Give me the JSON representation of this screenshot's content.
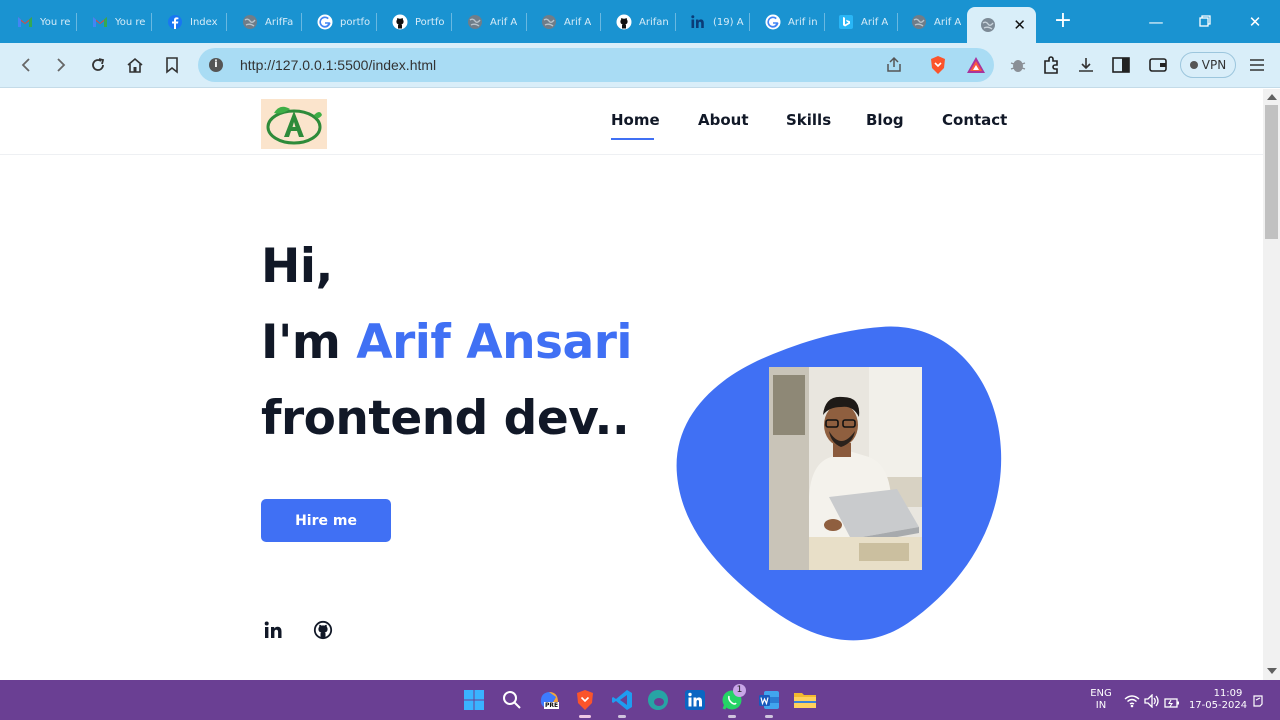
{
  "browser": {
    "tabs": [
      {
        "title": "You re",
        "icon": "gmail-icon"
      },
      {
        "title": "You re",
        "icon": "gmail-icon"
      },
      {
        "title": "Index",
        "icon": "facebook-icon"
      },
      {
        "title": "ArifFa",
        "icon": "globe-icon"
      },
      {
        "title": "portfo",
        "icon": "google-icon"
      },
      {
        "title": "Portfo",
        "icon": "github-icon"
      },
      {
        "title": "Arif A",
        "icon": "globe-icon"
      },
      {
        "title": "Arif A",
        "icon": "globe-icon"
      },
      {
        "title": "Arifan",
        "icon": "github-icon"
      },
      {
        "title": "(19) A",
        "icon": "linkedin-icon"
      },
      {
        "title": "Arif in",
        "icon": "google-icon"
      },
      {
        "title": "Arif A",
        "icon": "bing-icon"
      },
      {
        "title": "Arif A",
        "icon": "globe-icon"
      },
      {
        "title": "",
        "icon": "globe-icon",
        "active": true
      }
    ],
    "url": "http://127.0.0.1:5500/index.html",
    "vpn_label": "VPN"
  },
  "site": {
    "nav": {
      "home": "Home",
      "about": "About",
      "skills": "Skills",
      "blog": "Blog",
      "contact": "Contact"
    },
    "hero": {
      "greeting": "Hi,",
      "intro_prefix": "I'm ",
      "name": "Arif Ansari",
      "role": "frontend dev.."
    },
    "cta_label": "Hire me",
    "colors": {
      "accent": "#4070f4",
      "text": "#111827"
    }
  },
  "taskbar": {
    "lang_top": "ENG",
    "lang_bottom": "IN",
    "time": "11:09",
    "date": "17-05-2024",
    "whatsapp_badge": "1",
    "copilot_badge": "PRE"
  }
}
